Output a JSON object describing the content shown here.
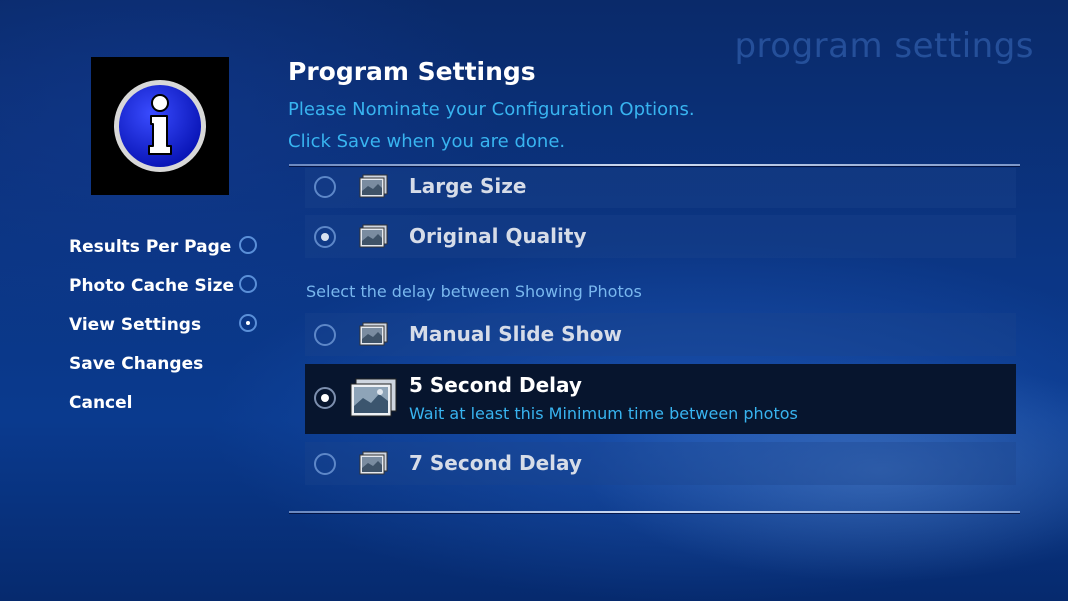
{
  "header": {
    "watermark": "program settings",
    "title": "Program Settings",
    "subtitle_line1": "Please Nominate your Configuration Options.",
    "subtitle_line2": "Click Save when you are done."
  },
  "sidebar": {
    "items": [
      {
        "label": "Results Per Page",
        "radio": true,
        "selected": false
      },
      {
        "label": "Photo Cache Size",
        "radio": true,
        "selected": false
      },
      {
        "label": "View Settings",
        "radio": true,
        "selected": true
      },
      {
        "label": "Save Changes",
        "radio": false
      },
      {
        "label": "Cancel",
        "radio": false
      }
    ]
  },
  "quality_options": [
    {
      "label": "Large Size",
      "selected": false
    },
    {
      "label": "Original Quality",
      "selected": true
    }
  ],
  "delay_section_label": "Select the delay between Showing Photos",
  "delay_options": [
    {
      "label": "Manual Slide Show",
      "selected": false
    },
    {
      "label": "5 Second Delay",
      "selected": true,
      "description": "Wait at least this Minimum time between photos"
    },
    {
      "label": "7 Second Delay",
      "selected": false
    }
  ],
  "icons": {
    "logo": "info-icon",
    "option_thumbnail": "photo-stack-icon"
  },
  "colors": {
    "accent_text": "#38b4f0",
    "info_icon_blue": "#1a2be0",
    "focused_row": "#07152e"
  }
}
